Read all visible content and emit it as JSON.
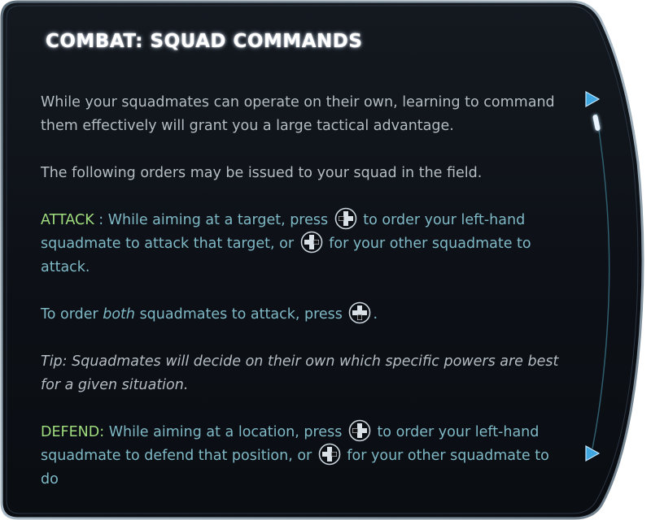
{
  "panel": {
    "title": "COMBAT: SQUAD COMMANDS"
  },
  "paragraphs": {
    "intro": "While your squadmates can operate on their own, learning to command them effectively will grant you a large tactical advantage.",
    "orders_intro": "The following orders may be issued to your squad in the field.",
    "attack_label": "ATTACK",
    "attack_sep": " : ",
    "attack_part1": "While aiming at a target, press ",
    "attack_part2": " to order your left-hand squadmate to attack that target, or ",
    "attack_part3": " for your other squadmate to attack.",
    "both_part1": "To order ",
    "both_emph": "both",
    "both_part2": " squadmates to attack, press ",
    "both_part3": ".",
    "tip": "Tip: Squadmates will decide on their own which specific powers are best for a given situation.",
    "defend_label": "DEFEND:",
    "defend_part1": " While aiming at a location, press ",
    "defend_part2": " to order your left-hand squadmate to defend that position, or ",
    "defend_part3": " for your other squadmate to do"
  },
  "icons": {
    "dpad_left": "dpad-left-icon",
    "dpad_right": "dpad-right-icon",
    "dpad_both": "dpad-down-icon",
    "scroll_up": "triangle-right-icon",
    "scroll_down": "triangle-right-icon"
  },
  "colors": {
    "panel_bg": "#0d1117",
    "border": "#8da3b4",
    "accent_teal": "#7fb9c6",
    "accent_green": "#9fdc7e",
    "body_text": "#b4bcc4",
    "arrow": "#3fa6e0"
  }
}
